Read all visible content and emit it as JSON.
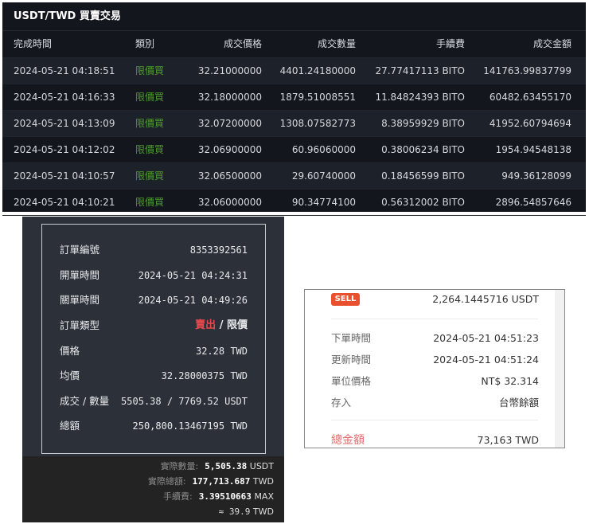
{
  "trades": {
    "title": "USDT/TWD 買賣交易",
    "headers": [
      "完成時間",
      "類別",
      "成交價格",
      "成交數量",
      "手續費",
      "成交金額"
    ],
    "rows": [
      [
        "2024-05-21 04:18:51",
        "限價買",
        "32.21000000",
        "4401.24180000",
        "27.77417113 BITO",
        "141763.99837799"
      ],
      [
        "2024-05-21 04:16:33",
        "限價買",
        "32.18000000",
        "1879.51008551",
        "11.84824393 BITO",
        "60482.63455170"
      ],
      [
        "2024-05-21 04:13:09",
        "限價買",
        "32.07200000",
        "1308.07582773",
        "8.38959929 BITO",
        "41952.60794694"
      ],
      [
        "2024-05-21 04:12:02",
        "限價買",
        "32.06900000",
        "60.96060000",
        "0.38006234 BITO",
        "1954.94548138"
      ],
      [
        "2024-05-21 04:10:57",
        "限價買",
        "32.06500000",
        "29.60740000",
        "0.18456599 BITO",
        "949.36128099"
      ],
      [
        "2024-05-21 04:10:21",
        "限價買",
        "32.06000000",
        "90.34774100",
        "0.56312002 BITO",
        "2896.54857646"
      ]
    ]
  },
  "order": {
    "rows": [
      {
        "label": "訂單編號",
        "value": "8353392561"
      },
      {
        "label": "開單時間",
        "value": "2024-05-21 04:24:31"
      },
      {
        "label": "關單時間",
        "value": "2024-05-21 04:49:26"
      },
      {
        "label": "訂單類型",
        "side": "賣出",
        "sep": "/",
        "type": "限價"
      },
      {
        "label": "價格",
        "value": "32.28 TWD"
      },
      {
        "label": "均價",
        "value": "32.28000375 TWD"
      },
      {
        "label": "成交 / 數量",
        "value": "5505.38 / 7769.52 USDT"
      },
      {
        "label": "總額",
        "value": "250,800.13467195 TWD"
      }
    ],
    "footer": [
      {
        "label": "實際數量:",
        "value": "5,505.38",
        "unit": "USDT"
      },
      {
        "label": "實際總額:",
        "value": "177,713.687",
        "unit": "TWD"
      },
      {
        "label": "手續費:",
        "value": "3.39510663",
        "unit": "MAX"
      },
      {
        "label": "",
        "value": "≈ 39.9",
        "unit": "TWD"
      }
    ]
  },
  "sell": {
    "badge": "SELL",
    "amount": "2,264.1445716 USDT",
    "rows": [
      {
        "label": "下單時間",
        "value": "2024-05-21 04:51:23"
      },
      {
        "label": "更新時間",
        "value": "2024-05-21 04:51:24"
      },
      {
        "label": "單位價格",
        "value": "NT$ 32.314"
      },
      {
        "label": "存入",
        "value": "台幣餘額"
      }
    ],
    "total_label": "總金額",
    "total_value": "73,163 TWD"
  },
  "colors": {
    "buy": "#4f9a2f",
    "sell": "#e5484d",
    "badge": "#e8502e"
  }
}
